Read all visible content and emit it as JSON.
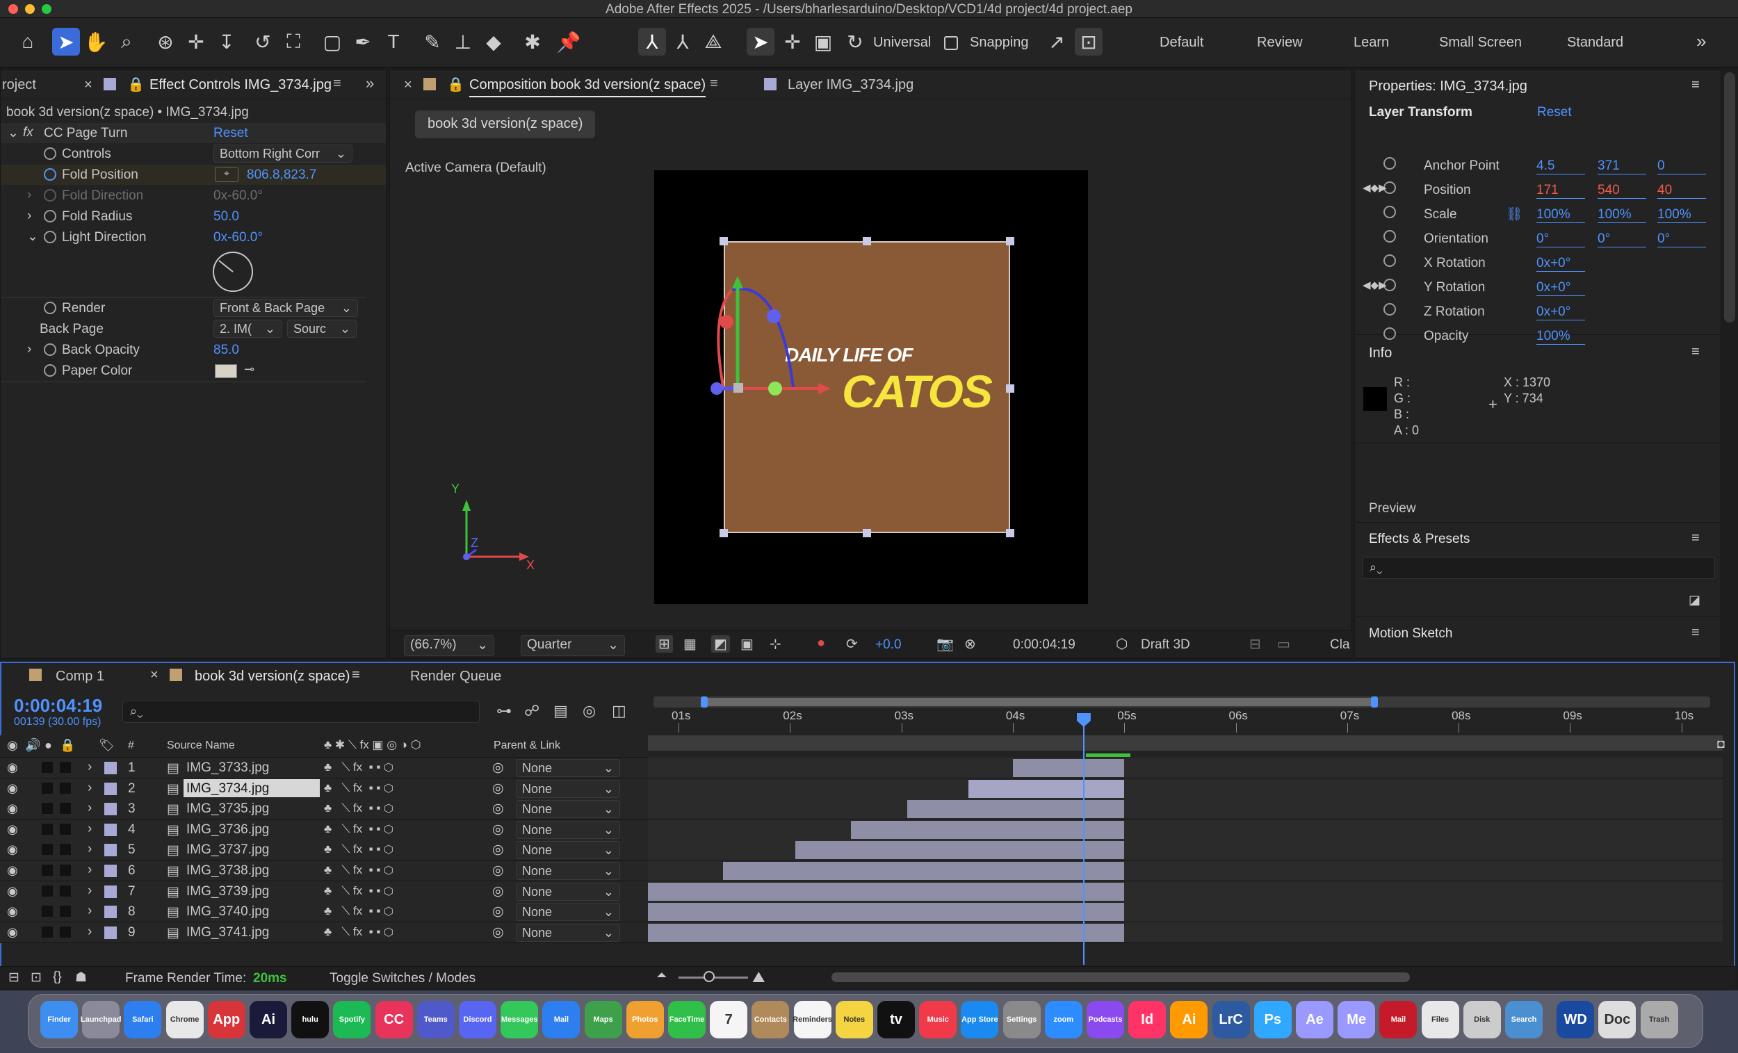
{
  "window": {
    "title": "Adobe After Effects 2025 - /Users/bharlesarduino/Desktop/VCD1/4d project/4d project.aep"
  },
  "toolbar": {
    "universal": "Universal",
    "snapping": "Snapping",
    "workspaces": [
      "Default",
      "Review",
      "Learn",
      "Small Screen",
      "Standard"
    ],
    "more": "»"
  },
  "effect_panel": {
    "tab_project": "roject",
    "tab_label": "Effect Controls IMG_3734.jpg",
    "breadcrumb": "book 3d version(z space) • IMG_3734.jpg",
    "effect_name": "CC Page Turn",
    "reset": "Reset",
    "props": [
      {
        "label": "Controls",
        "value": "Bottom Right Corr"
      },
      {
        "label": "Fold Position",
        "value": "806.8,823.7"
      },
      {
        "label": "Fold Direction",
        "value": "0x-60.0°"
      },
      {
        "label": "Fold Radius",
        "value": "50.0"
      },
      {
        "label": "Light Direction",
        "value": "0x-60.0°"
      },
      {
        "label": "Render",
        "value": "Front & Back Page"
      },
      {
        "label": "Back Page",
        "value": "2. IM(",
        "value2": "Sourc"
      },
      {
        "label": "Back Opacity",
        "value": "85.0"
      },
      {
        "label": "Paper Color",
        "value": ""
      }
    ]
  },
  "comp_panel": {
    "tab_label": "Composition book 3d version(z space)",
    "layer_tab": "Layer IMG_3734.jpg",
    "comp_button": "book 3d version(z space)",
    "camera": "Active Camera (Default)",
    "overlay_text1": "DAILY LIFE OF",
    "overlay_text2": "CATOS",
    "axis_y": "Y",
    "axis_z": "Z",
    "axis_x": "X",
    "zoom": "(66.7%)",
    "resolution": "Quarter",
    "exposure": "+0.0",
    "timecode": "0:00:04:19",
    "renderer": "Draft 3D",
    "cla": "Cla"
  },
  "properties": {
    "title": "Properties: IMG_3734.jpg",
    "section": "Layer Transform",
    "reset": "Reset",
    "rows": [
      {
        "label": "Anchor Point",
        "v": [
          "4.5",
          "371",
          "0"
        ]
      },
      {
        "label": "Position",
        "v": [
          "171",
          "540",
          "40"
        ]
      },
      {
        "label": "Scale",
        "v": [
          "100%",
          "100%",
          "100%"
        ]
      },
      {
        "label": "Orientation",
        "v": [
          "0°",
          "0°",
          "0°"
        ]
      },
      {
        "label": "X Rotation",
        "v": [
          "0x+0°"
        ]
      },
      {
        "label": "Y Rotation",
        "v": [
          "0x+0°"
        ]
      },
      {
        "label": "Z Rotation",
        "v": [
          "0x+0°"
        ]
      },
      {
        "label": "Opacity",
        "v": [
          "100%"
        ]
      }
    ]
  },
  "info": {
    "title": "Info",
    "r": "R :",
    "g": "G :",
    "b": "B :",
    "a": "A :  0",
    "x": "X : 1370",
    "y": "Y : 734"
  },
  "side_sections": {
    "preview": "Preview",
    "effects": "Effects & Presets",
    "motion": "Motion Sketch"
  },
  "timeline": {
    "tabs": [
      "Comp 1",
      "book 3d version(z space)",
      "Render Queue"
    ],
    "timecode": "0:00:04:19",
    "frames": "00139 (30.00 fps)",
    "col_num": "#",
    "col_source": "Source Name",
    "col_parent": "Parent & Link",
    "ticks": [
      "01s",
      "02s",
      "03s",
      "04s",
      "05s",
      "06s",
      "07s",
      "08s",
      "09s",
      "10s"
    ],
    "layers": [
      {
        "n": "1",
        "name": "IMG_3733.jpg",
        "parent": "None",
        "start": 4.0
      },
      {
        "n": "2",
        "name": "IMG_3734.jpg",
        "parent": "None",
        "start": 3.6
      },
      {
        "n": "3",
        "name": "IMG_3735.jpg",
        "parent": "None",
        "start": 3.05
      },
      {
        "n": "4",
        "name": "IMG_3736.jpg",
        "parent": "None",
        "start": 2.55
      },
      {
        "n": "5",
        "name": "IMG_3737.jpg",
        "parent": "None",
        "start": 2.05
      },
      {
        "n": "6",
        "name": "IMG_3738.jpg",
        "parent": "None",
        "start": 1.4
      },
      {
        "n": "7",
        "name": "IMG_3739.jpg",
        "parent": "None",
        "start": 0.7
      },
      {
        "n": "8",
        "name": "IMG_3740.jpg",
        "parent": "None",
        "start": 0.0
      },
      {
        "n": "9",
        "name": "IMG_3741.jpg",
        "parent": "None",
        "start": 0.0
      }
    ],
    "end": 5.0,
    "current": 4.63,
    "footer_render": "Frame Render Time:",
    "footer_ms": "20ms",
    "footer_toggle": "Toggle Switches / Modes"
  },
  "dock": [
    "Finder",
    "Launchpad",
    "Safari",
    "Chrome",
    "App",
    "Ai",
    "hulu",
    "Spotify",
    "CC",
    "Teams",
    "Discord",
    "Messages",
    "Mail",
    "Maps",
    "Photos",
    "FaceTime",
    "7",
    "Contacts",
    "Reminders",
    "Notes",
    "tv",
    "Music",
    "App Store",
    "Settings",
    "zoom",
    "Podcasts",
    "Id",
    "Ai",
    "LrC",
    "Ps",
    "Ae",
    "Me",
    "Mail",
    "Files",
    "Disk",
    "Search",
    "WD",
    "Doc",
    "Trash"
  ]
}
